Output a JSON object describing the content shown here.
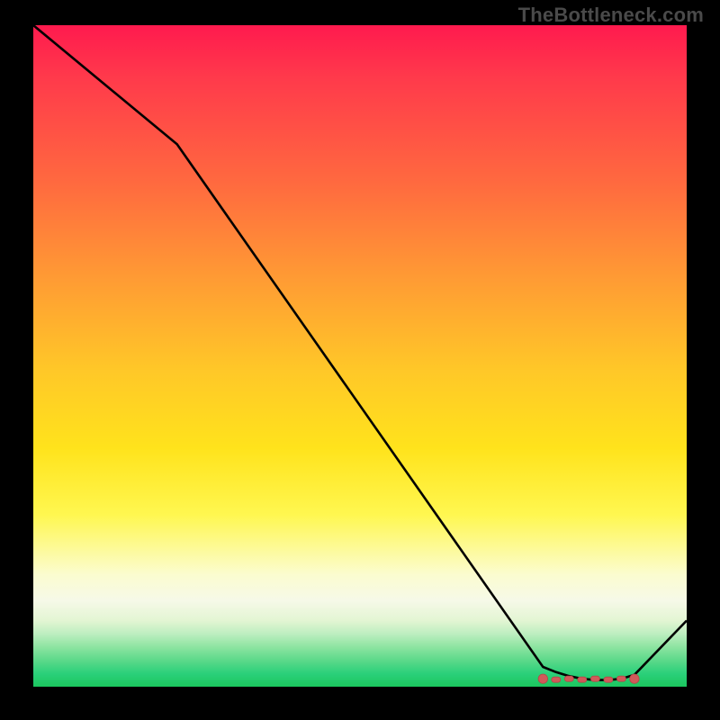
{
  "watermark": "TheBottleneck.com",
  "chart_data": {
    "type": "line",
    "title": "",
    "xlabel": "",
    "ylabel": "",
    "xlim": [
      0,
      100
    ],
    "ylim": [
      0,
      100
    ],
    "grid": false,
    "legend": false,
    "x": [
      0,
      22,
      78,
      80,
      82,
      84,
      86,
      88,
      90,
      92,
      100
    ],
    "values": [
      100,
      82,
      3,
      2.2,
      1.6,
      1.2,
      1.0,
      1.0,
      1.2,
      1.8,
      10
    ],
    "flat_region": {
      "x_start": 78,
      "x_end": 92,
      "y": 1.2
    },
    "flat_region_markers_y": 1.2,
    "flat_region_marker_x": [
      78,
      80,
      82,
      84,
      86,
      88,
      90,
      92
    ]
  },
  "colors": {
    "line": "#000000",
    "marker": "#d05a5a",
    "marker_stroke": "#b44848"
  }
}
